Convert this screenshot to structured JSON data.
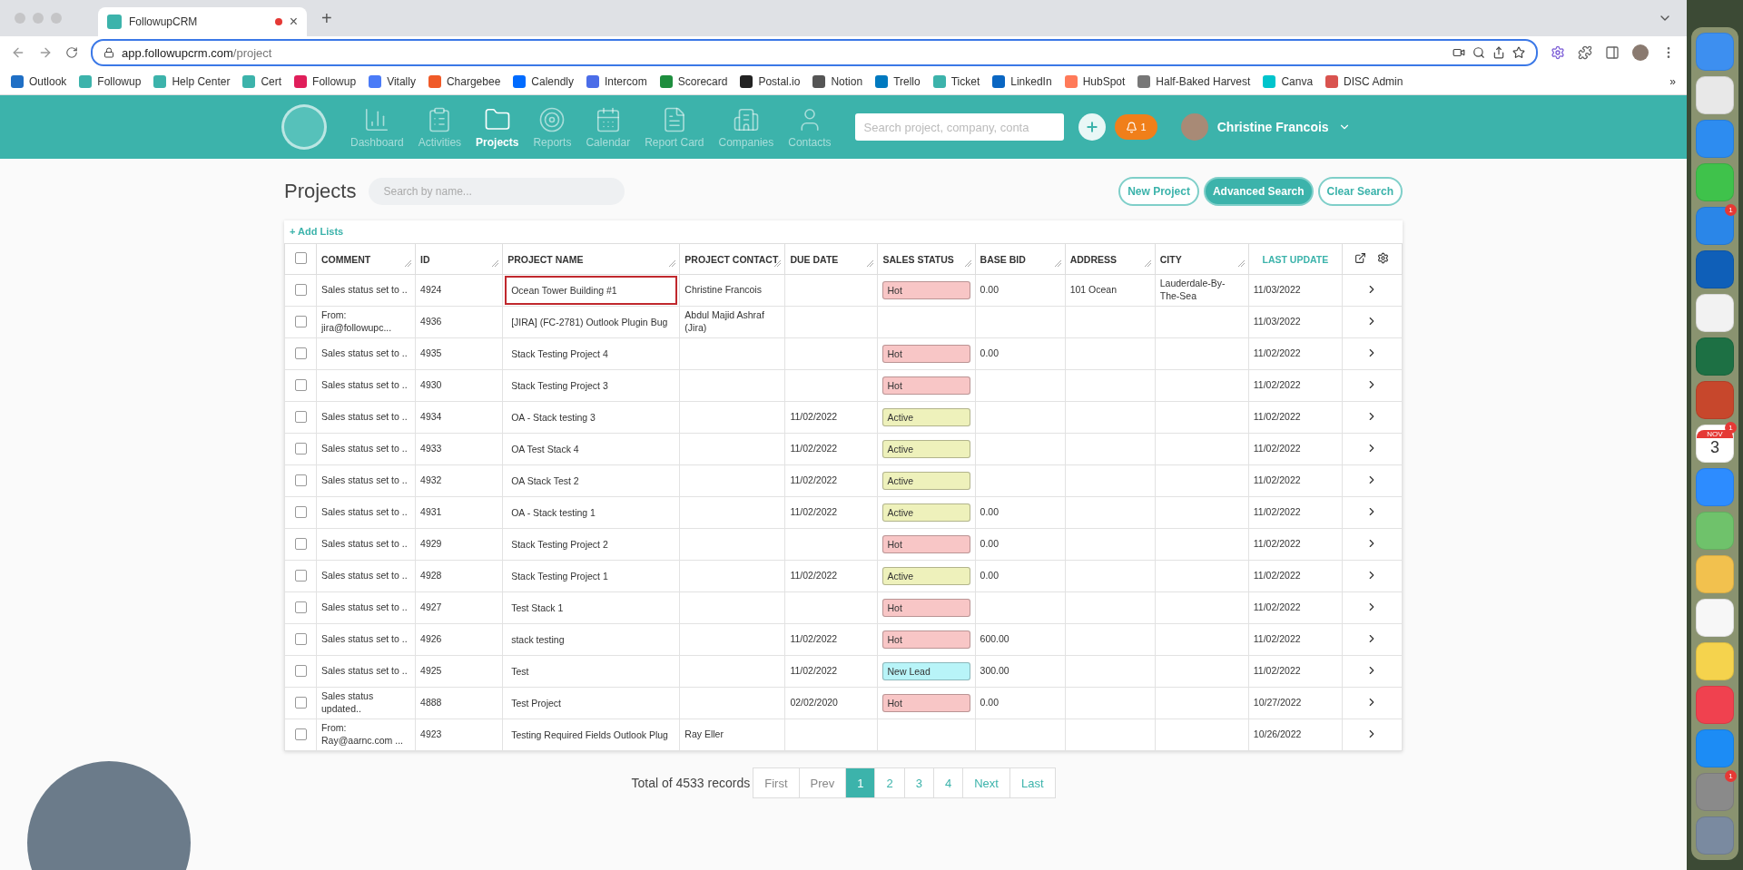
{
  "browser": {
    "tab": {
      "title": "FollowupCRM",
      "close": "×"
    },
    "new_tab": "+",
    "url": {
      "host": "app.followupcrm.com",
      "path": "/project"
    },
    "bookmarks": [
      {
        "label": "Outlook",
        "color": "#1f6fc5"
      },
      {
        "label": "Followup",
        "color": "#3cb3ab"
      },
      {
        "label": "Help Center",
        "color": "#3cb3ab"
      },
      {
        "label": "Cert",
        "color": "#3cb3ab"
      },
      {
        "label": "Followup",
        "color": "#e01e5a"
      },
      {
        "label": "Vitally",
        "color": "#4a7bf7"
      },
      {
        "label": "Chargebee",
        "color": "#f05a28"
      },
      {
        "label": "Calendly",
        "color": "#006bff"
      },
      {
        "label": "Intercom",
        "color": "#4b6de8"
      },
      {
        "label": "Scorecard",
        "color": "#1e8e3e"
      },
      {
        "label": "Postal.io",
        "color": "#222222"
      },
      {
        "label": "Notion",
        "color": "#555555"
      },
      {
        "label": "Trello",
        "color": "#0079bf"
      },
      {
        "label": "Ticket",
        "color": "#3cb3ab"
      },
      {
        "label": "LinkedIn",
        "color": "#0a66c2"
      },
      {
        "label": "HubSpot",
        "color": "#ff7a59"
      },
      {
        "label": "Half-Baked Harvest",
        "color": "#777777"
      },
      {
        "label": "Canva",
        "color": "#00c4cc"
      },
      {
        "label": "DISC Admin",
        "color": "#d9534f"
      }
    ],
    "more": "»"
  },
  "nav": {
    "items": [
      {
        "label": "Dashboard",
        "selected": false
      },
      {
        "label": "Activities",
        "selected": false
      },
      {
        "label": "Projects",
        "selected": true
      },
      {
        "label": "Reports",
        "selected": false
      },
      {
        "label": "Calendar",
        "selected": false
      },
      {
        "label": "Report Card",
        "selected": false
      },
      {
        "label": "Companies",
        "selected": false
      },
      {
        "label": "Contacts",
        "selected": false
      }
    ],
    "search": {
      "placeholder": "Search project, company, conta"
    },
    "notifications": "1",
    "user": "Christine Francois"
  },
  "page": {
    "title": "Projects",
    "search": {
      "placeholder": "Search by name..."
    },
    "buttons": [
      {
        "label": "New Project",
        "selected": false
      },
      {
        "label": "Advanced Search",
        "selected": true
      },
      {
        "label": "Clear Search",
        "selected": false
      }
    ],
    "add_lists": "+ Add Lists"
  },
  "table": {
    "select_all": false,
    "columns": [
      "COMMENT",
      "ID",
      "PROJECT NAME",
      "PROJECT CONTACT",
      "DUE DATE",
      "SALES STATUS",
      "BASE BID",
      "ADDRESS",
      "CITY",
      "LAST UPDATE"
    ],
    "rows": [
      {
        "checked": false,
        "highlighted": true,
        "comment": "Sales status set to ..",
        "id": "4924",
        "name": "Ocean Tower Building #1",
        "contact": "Christine Francois",
        "due": "",
        "status": {
          "text": "Hot",
          "color": "#f8c6c6"
        },
        "bid": "0.00",
        "address": "101 Ocean",
        "city": "Lauderdale-By-The-Sea",
        "updated": "11/03/2022"
      },
      {
        "checked": false,
        "highlighted": false,
        "comment": "From: jira@followupc...",
        "id": "4936",
        "name": "[JIRA] (FC-2781) Outlook Plugin Bug",
        "contact": "Abdul Majid Ashraf (Jira)",
        "due": "",
        "status": null,
        "bid": "",
        "address": "",
        "city": "",
        "updated": "11/03/2022"
      },
      {
        "checked": false,
        "highlighted": false,
        "comment": "Sales status set to ..",
        "id": "4935",
        "name": "Stack Testing Project 4",
        "contact": "",
        "due": "",
        "status": {
          "text": "Hot",
          "color": "#f8c6c6"
        },
        "bid": "0.00",
        "address": "",
        "city": "",
        "updated": "11/02/2022"
      },
      {
        "checked": false,
        "highlighted": false,
        "comment": "Sales status set to ..",
        "id": "4930",
        "name": "Stack Testing Project 3",
        "contact": "",
        "due": "",
        "status": {
          "text": "Hot",
          "color": "#f8c6c6"
        },
        "bid": "",
        "address": "",
        "city": "",
        "updated": "11/02/2022"
      },
      {
        "checked": false,
        "highlighted": false,
        "comment": "Sales status set to ..",
        "id": "4934",
        "name": "OA - Stack testing 3",
        "contact": "",
        "due": "11/02/2022",
        "status": {
          "text": "Active",
          "color": "#eef1bb"
        },
        "bid": "",
        "address": "",
        "city": "",
        "updated": "11/02/2022"
      },
      {
        "checked": false,
        "highlighted": false,
        "comment": "Sales status set to ..",
        "id": "4933",
        "name": "OA Test Stack 4",
        "contact": "",
        "due": "11/02/2022",
        "status": {
          "text": "Active",
          "color": "#eef1bb"
        },
        "bid": "",
        "address": "",
        "city": "",
        "updated": "11/02/2022"
      },
      {
        "checked": false,
        "highlighted": false,
        "comment": "Sales status set to ..",
        "id": "4932",
        "name": "OA Stack Test 2",
        "contact": "",
        "due": "11/02/2022",
        "status": {
          "text": "Active",
          "color": "#eef1bb"
        },
        "bid": "",
        "address": "",
        "city": "",
        "updated": "11/02/2022"
      },
      {
        "checked": false,
        "highlighted": false,
        "comment": "Sales status set to ..",
        "id": "4931",
        "name": "OA - Stack testing 1",
        "contact": "",
        "due": "11/02/2022",
        "status": {
          "text": "Active",
          "color": "#eef1bb"
        },
        "bid": "0.00",
        "address": "",
        "city": "",
        "updated": "11/02/2022"
      },
      {
        "checked": false,
        "highlighted": false,
        "comment": "Sales status set to ..",
        "id": "4929",
        "name": "Stack Testing Project 2",
        "contact": "",
        "due": "",
        "status": {
          "text": "Hot",
          "color": "#f8c6c6"
        },
        "bid": "0.00",
        "address": "",
        "city": "",
        "updated": "11/02/2022"
      },
      {
        "checked": false,
        "highlighted": false,
        "comment": "Sales status set to ..",
        "id": "4928",
        "name": "Stack Testing Project 1",
        "contact": "",
        "due": "11/02/2022",
        "status": {
          "text": "Active",
          "color": "#eef1bb"
        },
        "bid": "0.00",
        "address": "",
        "city": "",
        "updated": "11/02/2022"
      },
      {
        "checked": false,
        "highlighted": false,
        "comment": "Sales status set to ..",
        "id": "4927",
        "name": "Test Stack 1",
        "contact": "",
        "due": "",
        "status": {
          "text": "Hot",
          "color": "#f8c6c6"
        },
        "bid": "",
        "address": "",
        "city": "",
        "updated": "11/02/2022"
      },
      {
        "checked": false,
        "highlighted": false,
        "comment": "Sales status set to ..",
        "id": "4926",
        "name": "stack testing",
        "contact": "",
        "due": "11/02/2022",
        "status": {
          "text": "Hot",
          "color": "#f8c6c6"
        },
        "bid": "600.00",
        "address": "",
        "city": "",
        "updated": "11/02/2022"
      },
      {
        "checked": false,
        "highlighted": false,
        "comment": "Sales status set to ..",
        "id": "4925",
        "name": "Test",
        "contact": "",
        "due": "11/02/2022",
        "status": {
          "text": "New Lead",
          "color": "#b8f4f8"
        },
        "bid": "300.00",
        "address": "",
        "city": "",
        "updated": "11/02/2022"
      },
      {
        "checked": false,
        "highlighted": false,
        "comment": "Sales status updated..",
        "id": "4888",
        "name": "Test Project",
        "contact": "",
        "due": "02/02/2020",
        "status": {
          "text": "Hot",
          "color": "#f8c6c6"
        },
        "bid": "0.00",
        "address": "",
        "city": "",
        "updated": "10/27/2022"
      },
      {
        "checked": false,
        "highlighted": false,
        "comment": "From: Ray@aarnc.com ...",
        "id": "4923",
        "name": "Testing Required Fields Outlook Plug",
        "contact": "Ray Eller",
        "due": "",
        "status": null,
        "bid": "",
        "address": "",
        "city": "",
        "updated": "10/26/2022"
      }
    ]
  },
  "pagination": {
    "total": "Total of 4533 records",
    "buttons": [
      {
        "label": "First",
        "selected": false,
        "disabled": true
      },
      {
        "label": "Prev",
        "selected": false,
        "disabled": true
      },
      {
        "label": "1",
        "selected": true,
        "disabled": false
      },
      {
        "label": "2",
        "selected": false,
        "disabled": false
      },
      {
        "label": "3",
        "selected": false,
        "disabled": false
      },
      {
        "label": "4",
        "selected": false,
        "disabled": false
      },
      {
        "label": "Next",
        "selected": false,
        "disabled": false
      },
      {
        "label": "Last",
        "selected": false,
        "disabled": false
      }
    ]
  },
  "dock": [
    {
      "kind": "app",
      "color": "#3d8ff0"
    },
    {
      "kind": "app",
      "color": "#e8e8e8"
    },
    {
      "kind": "app",
      "color": "#2d8cf0"
    },
    {
      "kind": "app",
      "color": "#3fc24b"
    },
    {
      "kind": "app",
      "color": "#2a86e8",
      "badge": "1"
    },
    {
      "kind": "app",
      "color": "#0f5fb8"
    },
    {
      "kind": "app",
      "color": "#f2f2f2"
    },
    {
      "kind": "app",
      "color": "#1d7044"
    },
    {
      "kind": "app",
      "color": "#c7472c"
    },
    {
      "kind": "calendar",
      "color": "#ffffff",
      "month": "NOV",
      "day": "3",
      "badge": "1"
    },
    {
      "kind": "app",
      "color": "#2d8cff"
    },
    {
      "kind": "app",
      "color": "#6fc26b"
    },
    {
      "kind": "app",
      "color": "#f2c14e"
    },
    {
      "kind": "app",
      "color": "#f7f7f7"
    },
    {
      "kind": "app",
      "color": "#f5d34d"
    },
    {
      "kind": "app",
      "color": "#f0414f"
    },
    {
      "kind": "app",
      "color": "#1c8cf5"
    },
    {
      "kind": "app",
      "color": "#8a8a8a",
      "badge": "1"
    },
    {
      "kind": "app",
      "color": "#7a8aa0"
    }
  ]
}
